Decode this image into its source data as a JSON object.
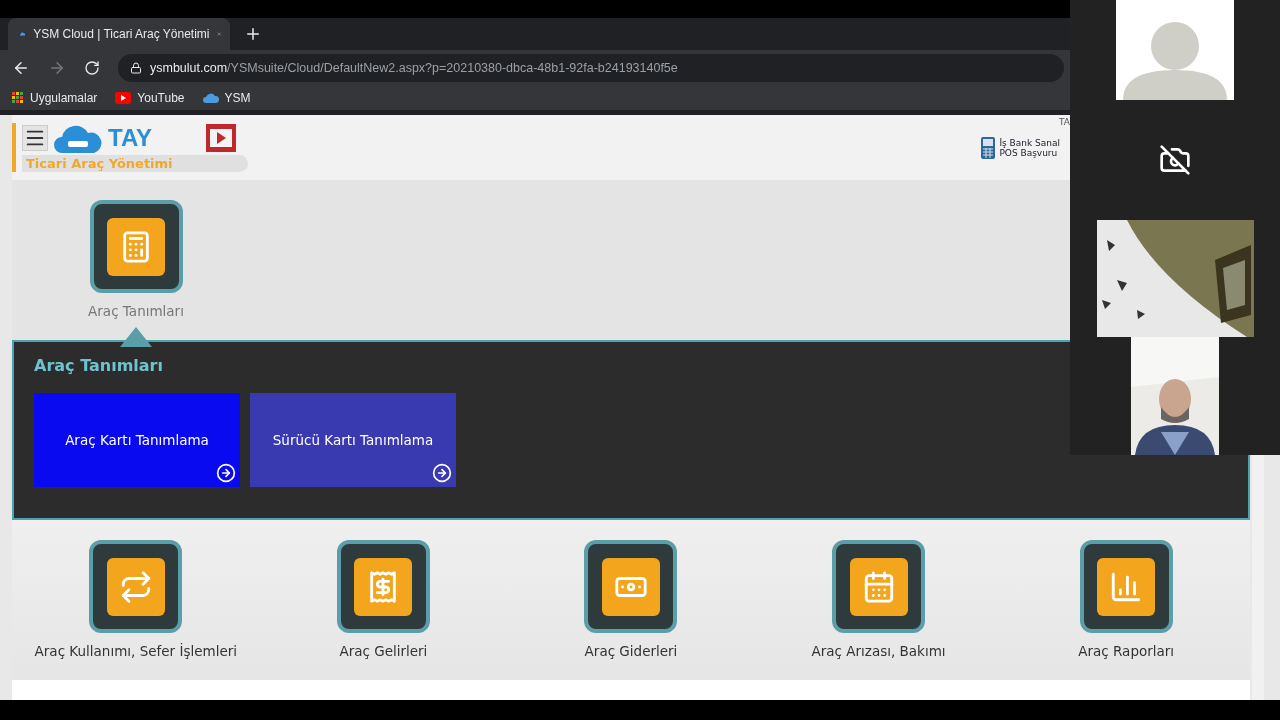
{
  "browser": {
    "tab": {
      "title": "YSM Cloud | Ticari Araç Yönetimi",
      "selected": true
    },
    "address": {
      "domain": "ysmbulut.com",
      "path": "/YSMsuite/Cloud/DefaultNew2.aspx?p=20210380-dbca-48b1-92fa-b24193140f5e"
    },
    "bookmarks": [
      {
        "label": "Uygulamalar",
        "kind": "apps"
      },
      {
        "label": "YouTube",
        "kind": "youtube"
      },
      {
        "label": "YSM",
        "kind": "cloud"
      }
    ]
  },
  "header": {
    "logo": "TAY",
    "subtitle": "Ticari Araç Yönetimi",
    "corner": "TA",
    "pos": [
      "İş Bank Sanal",
      "POS Başvuru"
    ]
  },
  "top_modules": [
    {
      "label": "Araç Tanımları",
      "selected": true
    }
  ],
  "panel": {
    "title": "Araç Tanımları",
    "tiles": [
      {
        "label": "Araç Kartı Tanımlama",
        "selected": true
      },
      {
        "label": "Sürücü Kartı Tanımlama",
        "selected": false
      }
    ]
  },
  "bottom_modules": [
    {
      "label": "Araç Kullanımı, Sefer İşlemleri",
      "selected": false
    },
    {
      "label": "Araç Gelirleri",
      "selected": false
    },
    {
      "label": "Araç Giderleri",
      "selected": false
    },
    {
      "label": "Araç Arızası, Bakımı",
      "selected": false
    },
    {
      "label": "Araç Raporları",
      "selected": false
    }
  ],
  "video_call": {
    "tiles": [
      {
        "kind": "avatar"
      },
      {
        "kind": "camera_off"
      },
      {
        "kind": "picture"
      },
      {
        "kind": "picture"
      }
    ]
  }
}
